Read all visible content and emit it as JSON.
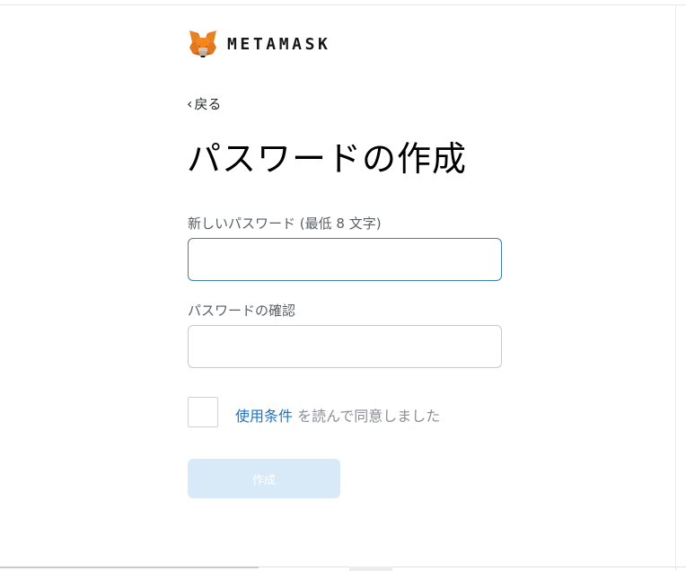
{
  "brand": {
    "name": "METAMASK",
    "logo_icon": "fox-icon"
  },
  "nav": {
    "back_chevron": "‹",
    "back_label": "戻る"
  },
  "page": {
    "title": "パスワードの作成"
  },
  "form": {
    "new_password": {
      "label": "新しいパスワード (最低 8 文字)",
      "value": "",
      "placeholder": ""
    },
    "confirm_password": {
      "label": "パスワードの確認",
      "value": "",
      "placeholder": ""
    },
    "terms": {
      "checked": false,
      "link_text": "使用条件",
      "suffix_text": " を読んで同意しました"
    },
    "submit": {
      "label": "作成",
      "enabled": false
    }
  },
  "colors": {
    "link": "#1f73bf",
    "focus_border": "#3b7fb7",
    "button_disabled_bg": "#d8eaf8",
    "fox_orange": "#e2761b"
  }
}
